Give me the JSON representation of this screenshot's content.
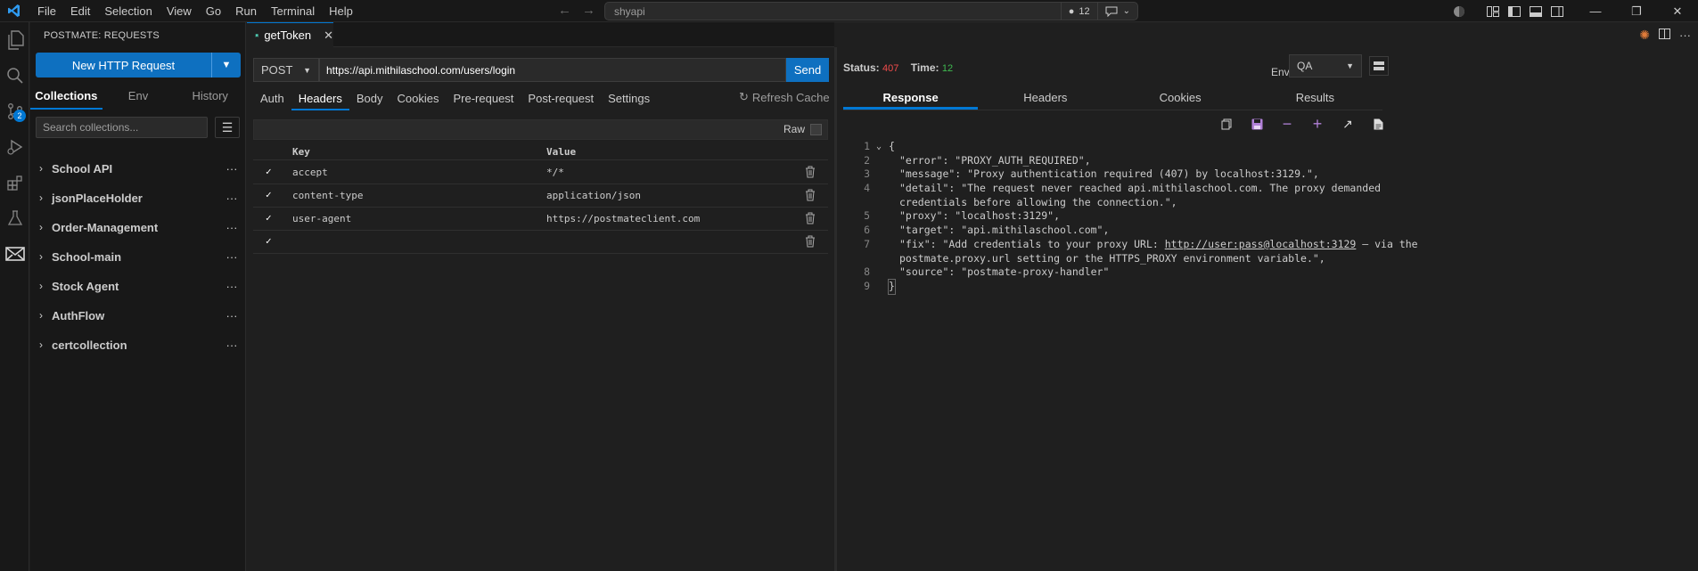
{
  "menu": [
    "File",
    "Edit",
    "Selection",
    "View",
    "Go",
    "Run",
    "Terminal",
    "Help"
  ],
  "command_center": {
    "query": "shyapi",
    "badge_count": "12"
  },
  "activity_badge": "2",
  "sidebar": {
    "title": "POSTMATE: REQUESTS",
    "new_request": "New HTTP Request",
    "tabs": [
      "Collections",
      "Env",
      "History"
    ],
    "search_placeholder": "Search collections...",
    "collections": [
      "School API",
      "jsonPlaceHolder",
      "Order-Management",
      "School-main",
      "Stock Agent",
      "AuthFlow",
      "certcollection"
    ]
  },
  "editor_tab": "getToken",
  "request": {
    "method": "POST",
    "url": "https://api.mithilaschool.com/users/login",
    "send": "Send",
    "tabs": [
      "Auth",
      "Headers",
      "Body",
      "Cookies",
      "Pre-request",
      "Post-request",
      "Settings"
    ],
    "refresh": "Refresh Cache",
    "raw": "Raw",
    "col_key": "Key",
    "col_value": "Value",
    "headers": [
      {
        "key": "accept",
        "value": "*/*"
      },
      {
        "key": "content-type",
        "value": "application/json"
      },
      {
        "key": "user-agent",
        "value": "https://postmateclient.com"
      },
      {
        "key": "",
        "value": ""
      }
    ]
  },
  "response": {
    "status_label": "Status:",
    "status_value": "407",
    "time_label": "Time:",
    "time_value": "12",
    "env_label": "Env",
    "env_value": "QA",
    "tabs": [
      "Response",
      "Headers",
      "Cookies",
      "Results"
    ],
    "lines": [
      {
        "n": "1",
        "t": "{"
      },
      {
        "n": "2",
        "t": "\"error\": \"PROXY_AUTH_REQUIRED\","
      },
      {
        "n": "3",
        "t": "\"message\": \"Proxy authentication required (407) by localhost:3129.\","
      },
      {
        "n": "4",
        "t": "\"detail\": \"The request never reached api.mithilaschool.com. The proxy demanded"
      },
      {
        "n": "",
        "t": "credentials before allowing the connection.\","
      },
      {
        "n": "5",
        "t": "\"proxy\": \"localhost:3129\","
      },
      {
        "n": "6",
        "t": "\"target\": \"api.mithilaschool.com\","
      },
      {
        "n": "7",
        "t": "\"fix\": \"Add credentials to your proxy URL: "
      },
      {
        "n": "",
        "t": "postmate.proxy.url setting or the HTTPS_PROXY environment variable.\","
      },
      {
        "n": "8",
        "t": "\"source\": \"postmate-proxy-handler\""
      },
      {
        "n": "9",
        "t": "}"
      }
    ],
    "fix_link": "http://user:pass@localhost:3129",
    "fix_tail": " — via the"
  },
  "colors": {
    "accent": "#0078d4",
    "status_error": "#f14c4c",
    "time_ok": "#3fb950",
    "purple_tool": "#b180d7"
  }
}
